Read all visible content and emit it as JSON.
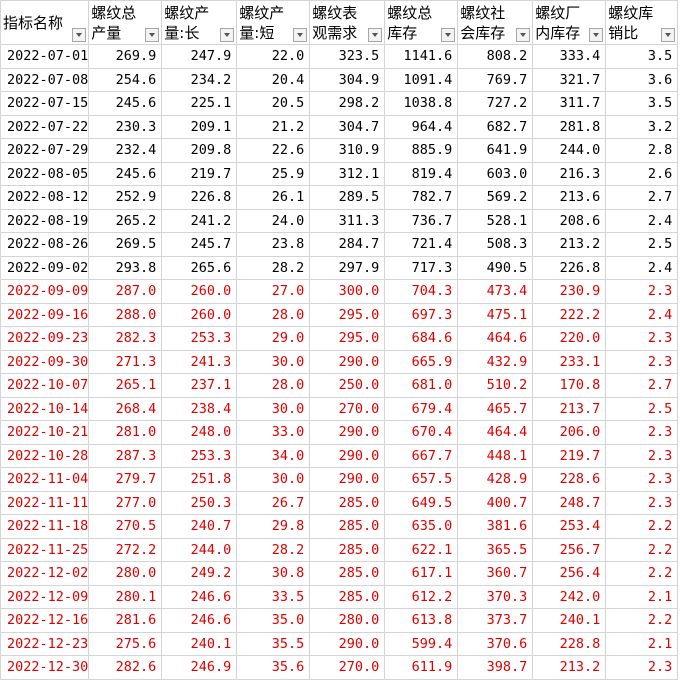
{
  "headers": [
    {
      "name": "指标名称",
      "label": "指标名称"
    },
    {
      "name": "螺纹总产量",
      "label": "螺纹总产量"
    },
    {
      "name": "螺纹产量:长",
      "label": "螺纹产量:长"
    },
    {
      "name": "螺纹产量:短",
      "label": "螺纹产量:短"
    },
    {
      "name": "螺纹表观需求",
      "label": "螺纹表观需求"
    },
    {
      "name": "螺纹总库存",
      "label": "螺纹总库存"
    },
    {
      "name": "螺纹社会库存",
      "label": "螺纹社会库存"
    },
    {
      "name": "螺纹厂内库存",
      "label": "螺纹厂内库存"
    },
    {
      "name": "螺纹库销比",
      "label": "螺纹库销比"
    }
  ],
  "colors": {
    "historical": "#000000",
    "forecast": "#e00000",
    "grid": "#d4d4d4"
  },
  "rows": [
    {
      "forecast": false,
      "cells": [
        "2022-07-01",
        "269.9",
        "247.9",
        "22.0",
        "323.5",
        "1141.6",
        "808.2",
        "333.4",
        "3.5"
      ]
    },
    {
      "forecast": false,
      "cells": [
        "2022-07-08",
        "254.6",
        "234.2",
        "20.4",
        "304.9",
        "1091.4",
        "769.7",
        "321.7",
        "3.6"
      ]
    },
    {
      "forecast": false,
      "cells": [
        "2022-07-15",
        "245.6",
        "225.1",
        "20.5",
        "298.2",
        "1038.8",
        "727.2",
        "311.7",
        "3.5"
      ]
    },
    {
      "forecast": false,
      "cells": [
        "2022-07-22",
        "230.3",
        "209.1",
        "21.2",
        "304.7",
        "964.4",
        "682.7",
        "281.8",
        "3.2"
      ]
    },
    {
      "forecast": false,
      "cells": [
        "2022-07-29",
        "232.4",
        "209.8",
        "22.6",
        "310.9",
        "885.9",
        "641.9",
        "244.0",
        "2.8"
      ]
    },
    {
      "forecast": false,
      "cells": [
        "2022-08-05",
        "245.6",
        "219.7",
        "25.9",
        "312.1",
        "819.4",
        "603.0",
        "216.3",
        "2.6"
      ]
    },
    {
      "forecast": false,
      "cells": [
        "2022-08-12",
        "252.9",
        "226.8",
        "26.1",
        "289.5",
        "782.7",
        "569.2",
        "213.6",
        "2.7"
      ]
    },
    {
      "forecast": false,
      "cells": [
        "2022-08-19",
        "265.2",
        "241.2",
        "24.0",
        "311.3",
        "736.7",
        "528.1",
        "208.6",
        "2.4"
      ]
    },
    {
      "forecast": false,
      "cells": [
        "2022-08-26",
        "269.5",
        "245.7",
        "23.8",
        "284.7",
        "721.4",
        "508.3",
        "213.2",
        "2.5"
      ]
    },
    {
      "forecast": false,
      "cells": [
        "2022-09-02",
        "293.8",
        "265.6",
        "28.2",
        "297.9",
        "717.3",
        "490.5",
        "226.8",
        "2.4"
      ]
    },
    {
      "forecast": true,
      "cells": [
        "2022-09-09",
        "287.0",
        "260.0",
        "27.0",
        "300.0",
        "704.3",
        "473.4",
        "230.9",
        "2.3"
      ]
    },
    {
      "forecast": true,
      "cells": [
        "2022-09-16",
        "288.0",
        "260.0",
        "28.0",
        "295.0",
        "697.3",
        "475.1",
        "222.2",
        "2.4"
      ]
    },
    {
      "forecast": true,
      "cells": [
        "2022-09-23",
        "282.3",
        "253.3",
        "29.0",
        "295.0",
        "684.6",
        "464.6",
        "220.0",
        "2.3"
      ]
    },
    {
      "forecast": true,
      "cells": [
        "2022-09-30",
        "271.3",
        "241.3",
        "30.0",
        "290.0",
        "665.9",
        "432.9",
        "233.1",
        "2.3"
      ]
    },
    {
      "forecast": true,
      "cells": [
        "2022-10-07",
        "265.1",
        "237.1",
        "28.0",
        "250.0",
        "681.0",
        "510.2",
        "170.8",
        "2.7"
      ]
    },
    {
      "forecast": true,
      "cells": [
        "2022-10-14",
        "268.4",
        "238.4",
        "30.0",
        "270.0",
        "679.4",
        "465.7",
        "213.7",
        "2.5"
      ]
    },
    {
      "forecast": true,
      "cells": [
        "2022-10-21",
        "281.0",
        "248.0",
        "33.0",
        "290.0",
        "670.4",
        "464.4",
        "206.0",
        "2.3"
      ]
    },
    {
      "forecast": true,
      "cells": [
        "2022-10-28",
        "287.3",
        "253.3",
        "34.0",
        "290.0",
        "667.7",
        "448.1",
        "219.7",
        "2.3"
      ]
    },
    {
      "forecast": true,
      "cells": [
        "2022-11-04",
        "279.7",
        "251.8",
        "30.0",
        "290.0",
        "657.5",
        "428.9",
        "228.6",
        "2.3"
      ]
    },
    {
      "forecast": true,
      "cells": [
        "2022-11-11",
        "277.0",
        "250.3",
        "26.7",
        "285.0",
        "649.5",
        "400.7",
        "248.7",
        "2.3"
      ]
    },
    {
      "forecast": true,
      "cells": [
        "2022-11-18",
        "270.5",
        "240.7",
        "29.8",
        "285.0",
        "635.0",
        "381.6",
        "253.4",
        "2.2"
      ]
    },
    {
      "forecast": true,
      "cells": [
        "2022-11-25",
        "272.2",
        "244.0",
        "28.2",
        "285.0",
        "622.1",
        "365.5",
        "256.7",
        "2.2"
      ]
    },
    {
      "forecast": true,
      "cells": [
        "2022-12-02",
        "280.0",
        "249.2",
        "30.8",
        "285.0",
        "617.1",
        "360.7",
        "256.4",
        "2.2"
      ]
    },
    {
      "forecast": true,
      "cells": [
        "2022-12-09",
        "280.1",
        "246.6",
        "33.5",
        "285.0",
        "612.2",
        "370.3",
        "242.0",
        "2.1"
      ]
    },
    {
      "forecast": true,
      "cells": [
        "2022-12-16",
        "281.6",
        "246.6",
        "35.0",
        "280.0",
        "613.8",
        "373.7",
        "240.1",
        "2.2"
      ]
    },
    {
      "forecast": true,
      "cells": [
        "2022-12-23",
        "275.6",
        "240.1",
        "35.5",
        "290.0",
        "599.4",
        "370.6",
        "228.8",
        "2.1"
      ]
    },
    {
      "forecast": true,
      "cells": [
        "2022-12-30",
        "282.6",
        "246.9",
        "35.6",
        "270.0",
        "611.9",
        "398.7",
        "213.2",
        "2.3"
      ]
    }
  ]
}
